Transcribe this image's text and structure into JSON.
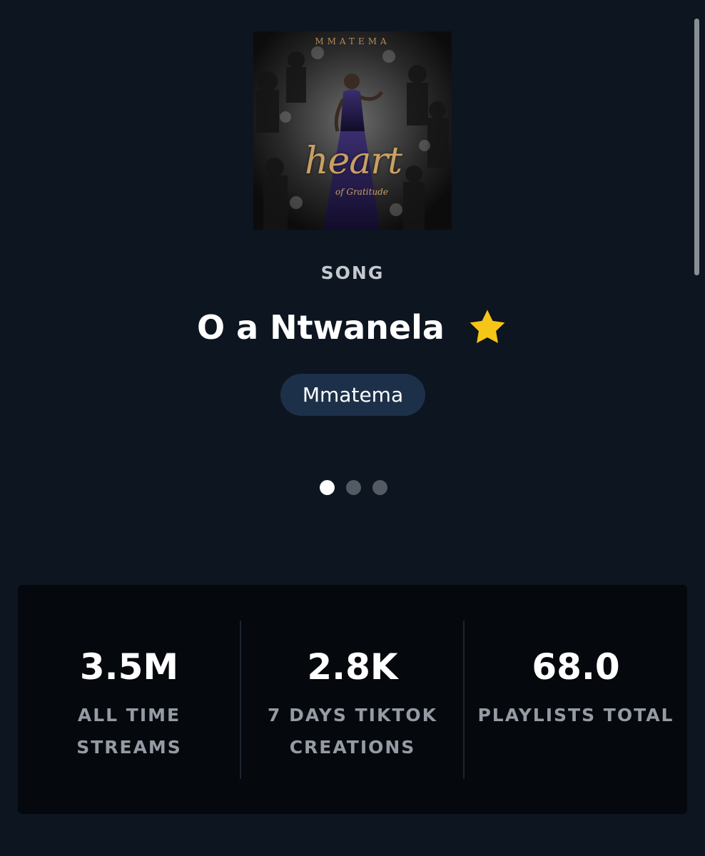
{
  "cover": {
    "brand_text": "MMATEMA",
    "title_text": "heart",
    "subtitle_text": "of Gratitude"
  },
  "type_label": "SONG",
  "song_title": "O a Ntwanela",
  "artist": "Mmatema",
  "carousel": {
    "page_count": 3,
    "active_index": 0
  },
  "stats": [
    {
      "value": "3.5M",
      "label": "ALL TIME STREAMS"
    },
    {
      "value": "2.8K",
      "label": "7 DAYS TIKTOK CREATIONS"
    },
    {
      "value": "68.0",
      "label": "PLAYLISTS TOTAL"
    }
  ],
  "colors": {
    "background": "#0d1520",
    "card": "#05080c",
    "pill": "#1d3049",
    "star": "#f5c518",
    "label": "#959ba4"
  },
  "icons": {
    "favorite": "star-icon"
  }
}
